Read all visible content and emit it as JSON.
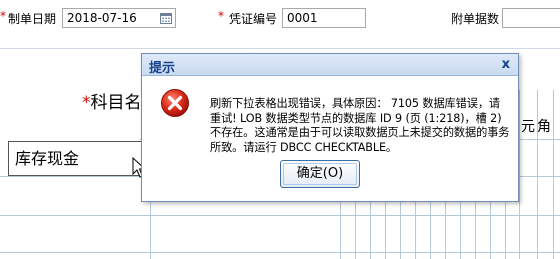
{
  "form": {
    "date_label": "制单日期",
    "date_value": "2018-07-16",
    "voucher_label": "凭证编号",
    "voucher_value": "0001",
    "attach_label": "附单据数",
    "attach_value": "",
    "required_mark": "*"
  },
  "grid": {
    "subject_label": "科目名称",
    "subject_value": "库存现金",
    "unit_yuan": "元",
    "unit_jiao": "角"
  },
  "dialog": {
    "title": "提示",
    "close": "x",
    "message": "刷新下拉表格出现错误，具体原因： 7105 数据库错误，请重试! LOB 数据类型节点的数据库 ID 9 (页 (1:218)，槽 2)不存在。这通常是由于可以读取数据页上未提交的数据的事务所致。请运行 DBCC CHECKTABLE。",
    "ok_label": "确定(O)"
  },
  "colors": {
    "required": "#d40000",
    "dialog_title": "#15428b",
    "error_icon": "#d42020"
  },
  "icons": {
    "calendar": "calendar-icon",
    "error": "error-icon",
    "cursor": "mouse-pointer-icon"
  }
}
